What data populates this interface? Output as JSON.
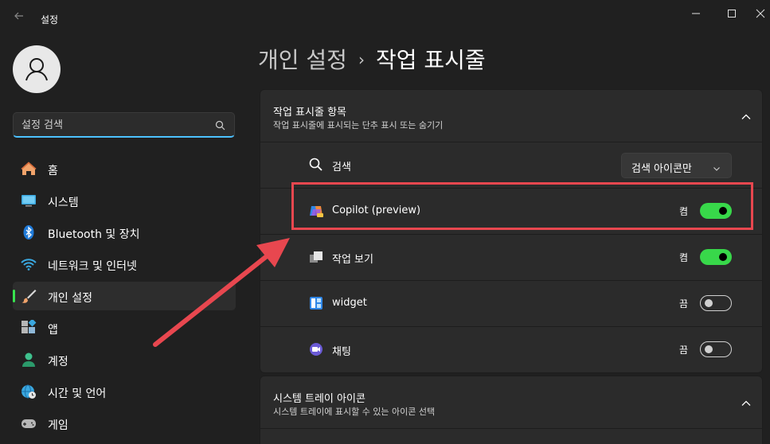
{
  "window": {
    "title": "설정",
    "back_icon": "back-arrow-icon",
    "controls": [
      "minimize-icon",
      "maximize-icon",
      "close-icon"
    ]
  },
  "sidebar": {
    "avatar_icon": "user-avatar-icon",
    "search": {
      "placeholder": "설정 검색",
      "value": "",
      "icon": "search-icon"
    },
    "items": [
      {
        "label": "홈",
        "icon": "home-icon",
        "active": false
      },
      {
        "label": "시스템",
        "icon": "monitor-icon",
        "active": false
      },
      {
        "label": "Bluetooth 및 장치",
        "icon": "bluetooth-icon",
        "active": false
      },
      {
        "label": "네트워크 및 인터넷",
        "icon": "wifi-icon",
        "active": false
      },
      {
        "label": "개인 설정",
        "icon": "brush-icon",
        "active": true
      },
      {
        "label": "앱",
        "icon": "apps-icon",
        "active": false
      },
      {
        "label": "계정",
        "icon": "account-icon",
        "active": false
      },
      {
        "label": "시간 및 언어",
        "icon": "globe-clock-icon",
        "active": false
      },
      {
        "label": "게임",
        "icon": "gamepad-icon",
        "active": false
      }
    ]
  },
  "main": {
    "breadcrumb": {
      "parent": "개인 설정",
      "separator": "›",
      "current": "작업 표시줄"
    },
    "taskbar_items": {
      "title": "작업 표시줄 항목",
      "subtitle": "작업 표시줄에 표시되는 단추 표시 또는 숨기기",
      "rows": [
        {
          "label": "검색",
          "icon": "search-icon",
          "control": "dropdown",
          "value": "검색 아이콘만"
        },
        {
          "label": "Copilot (preview)",
          "icon": "copilot-icon",
          "control": "toggle",
          "state": "켬",
          "on": true
        },
        {
          "label": "작업 보기",
          "icon": "task-view-icon",
          "control": "toggle",
          "state": "켬",
          "on": true
        },
        {
          "label": "widget",
          "icon": "widgets-icon",
          "control": "toggle",
          "state": "끔",
          "on": false
        },
        {
          "label": "채팅",
          "icon": "chat-icon",
          "control": "toggle",
          "state": "끔",
          "on": false
        }
      ]
    },
    "system_tray": {
      "title": "시스템 트레이 아이콘",
      "subtitle": "시스템 트레이에 표시할 수 있는 아이콘 선택"
    }
  },
  "colors": {
    "accent_green": "#38d84a",
    "accent_blue": "#4cc2ff",
    "annotation_red": "#e8474f",
    "background": "#202020",
    "card": "#2b2b2b"
  }
}
